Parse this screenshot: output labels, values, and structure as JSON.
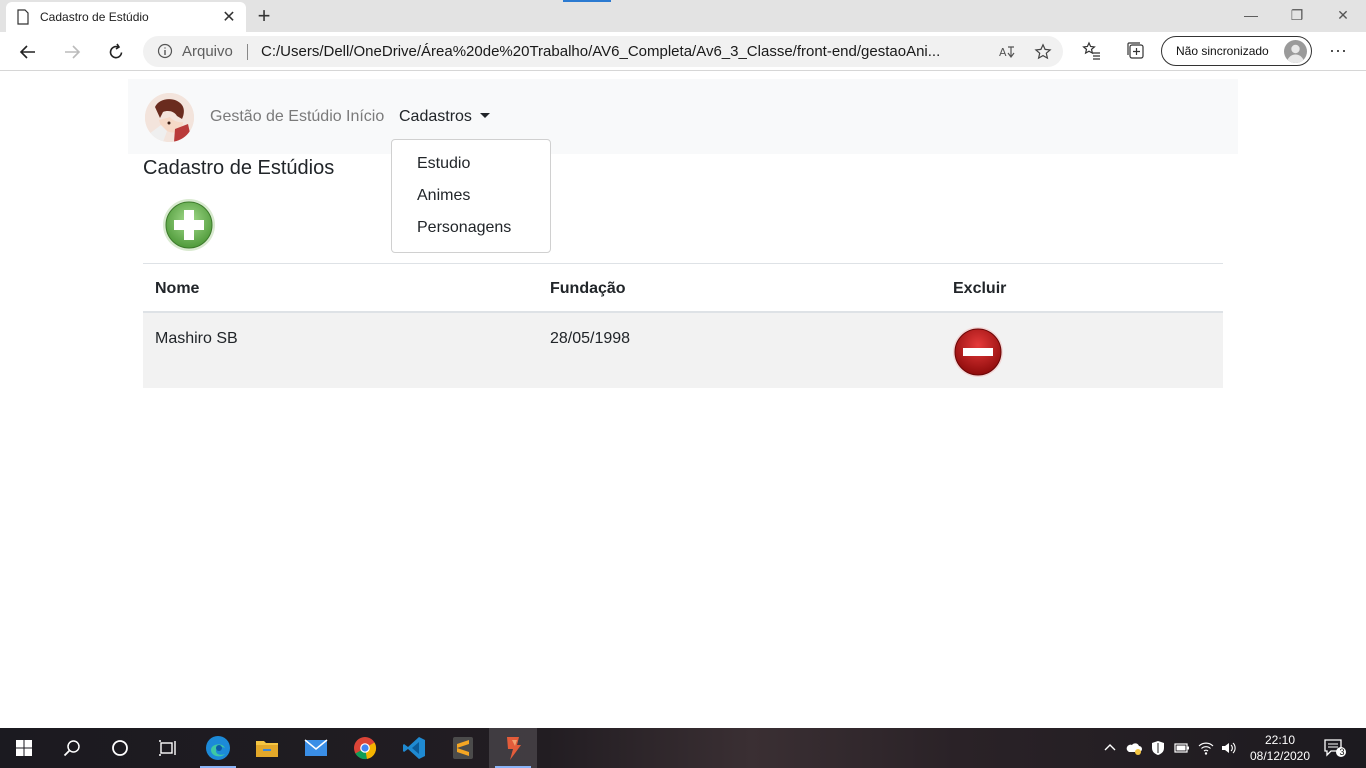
{
  "browser": {
    "tab_title": "Cadastro de Estúdio",
    "new_tab_symbol": "+",
    "address_prefix": "Arquivo",
    "url": "C:/Users/Dell/OneDrive/Área%20de%20Trabalho/AV6_Completa/Av6_3_Classe/front-end/gestaoAni...",
    "sync_label": "Não sincronizado",
    "more_symbol": "···"
  },
  "navbar": {
    "brand": "Gestão de Estúdio",
    "inicio": "Início",
    "cadastros": "Cadastros",
    "dropdown": [
      "Estudio",
      "Animes",
      "Personagens"
    ]
  },
  "page": {
    "title": "Cadastro de Estúdios"
  },
  "table": {
    "headers": {
      "nome": "Nome",
      "fundacao": "Fundação",
      "excluir": "Excluir"
    },
    "rows": [
      {
        "nome": "Mashiro SB",
        "fundacao": "28/05/1998"
      }
    ]
  },
  "taskbar": {
    "time": "22:10",
    "date": "08/12/2020",
    "notification_count": "3"
  },
  "icons": [
    "page-icon",
    "close-icon",
    "back-arrow-icon",
    "forward-arrow-icon",
    "refresh-icon",
    "info-icon",
    "read-aloud-icon",
    "favorite-star-icon",
    "favorites-icon",
    "collections-icon",
    "profile-icon",
    "add-icon",
    "delete-icon",
    "windows-start-icon",
    "search-icon",
    "cortana-icon",
    "task-view-icon",
    "edge-icon",
    "file-explorer-icon",
    "mail-icon",
    "chrome-icon",
    "vscode-icon",
    "sublime-icon",
    "app-icon",
    "chevron-up-icon",
    "onedrive-icon",
    "defender-icon",
    "battery-icon",
    "wifi-icon",
    "volume-icon",
    "notification-icon"
  ]
}
